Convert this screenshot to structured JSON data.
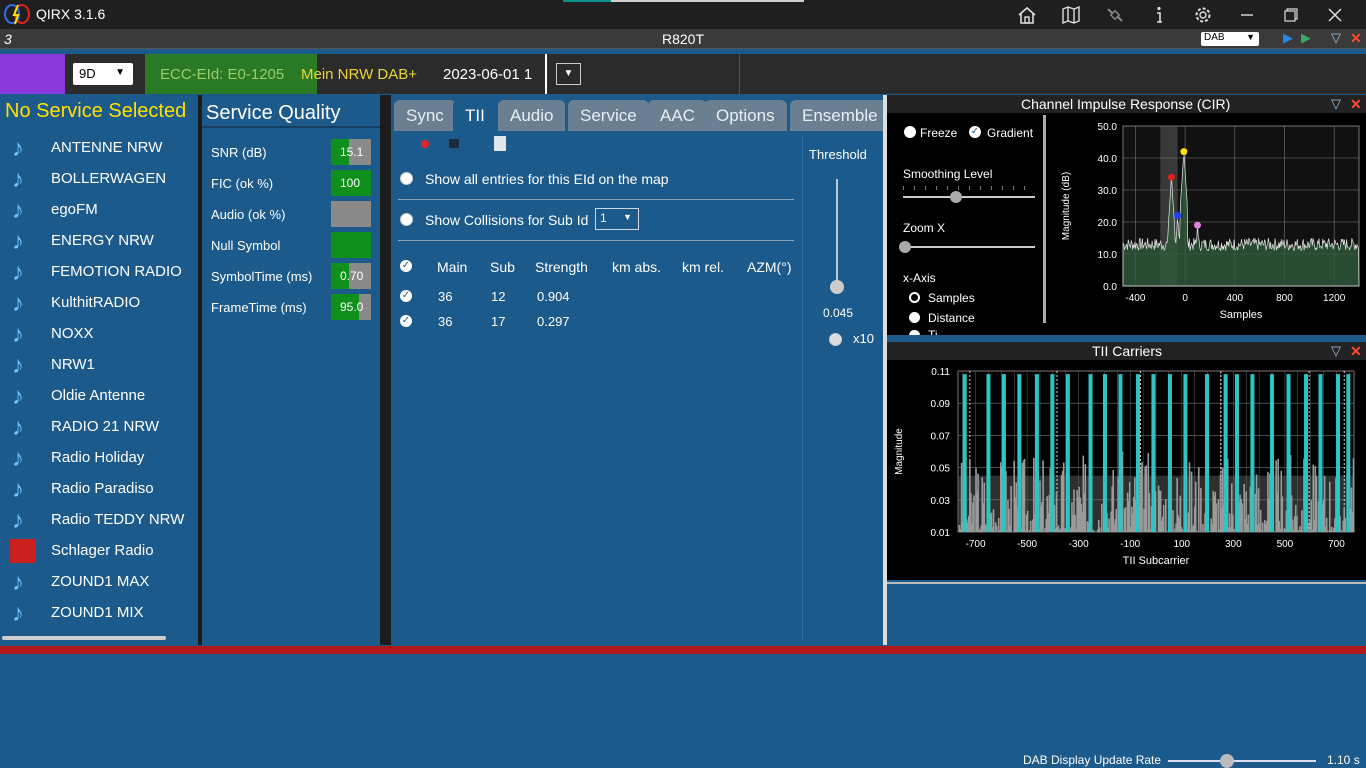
{
  "app": {
    "title": "QIRX 3.1.6"
  },
  "titlebar_icons": [
    "home-icon",
    "map-icon",
    "satellite-icon",
    "info-icon",
    "gear-icon",
    "minimize-icon",
    "restore-icon",
    "close-icon"
  ],
  "device_bar": {
    "number": "3",
    "device": "R820T",
    "mode": "DAB"
  },
  "channel_bar": {
    "channel": "9D",
    "ecc": "ECC-EId: E0-1205",
    "ensemble": "Mein NRW DAB+",
    "date": "2023-06-01  1"
  },
  "service_list": {
    "title": "No Service Selected",
    "items": [
      "ANTENNE NRW",
      "BOLLERWAGEN",
      "egoFM",
      "ENERGY NRW",
      "FEMOTION RADIO",
      "KulthitRADIO",
      "NOXX",
      "NRW1",
      "Oldie Antenne",
      "RADIO 21 NRW",
      "Radio Holiday",
      "Radio Paradiso",
      "Radio TEDDY NRW",
      "Schlager Radio",
      "ZOUND1 MAX",
      "ZOUND1 MIX"
    ]
  },
  "quality": {
    "title": "Service Quality",
    "rows": [
      {
        "label": "SNR (dB)",
        "value": "15.1",
        "fill": 0.45
      },
      {
        "label": "FIC (ok %)",
        "value": "100",
        "fill": 1.0
      },
      {
        "label": "Audio (ok %)",
        "value": "",
        "fill": 0
      },
      {
        "label": "Null Symbol",
        "value": "",
        "fill": 1.0
      },
      {
        "label": "SymbolTime (ms)",
        "value": "0.70",
        "fill": 0.45
      },
      {
        "label": "FrameTime (ms)",
        "value": "95.0",
        "fill": 0.7
      }
    ]
  },
  "tii": {
    "tabs": [
      "Sync",
      "TII",
      "Audio",
      "Service",
      "AAC",
      "Options",
      "Ensemble"
    ],
    "active_tab": "TII",
    "show_all_label": "Show all entries for this EId on the map",
    "show_collisions_label": "Show Collisions for Sub Id",
    "sub_id": "1",
    "threshold_label": "Threshold",
    "threshold_value": "0.045",
    "x10_label": "x10",
    "columns": [
      "Main",
      "Sub",
      "Strength",
      "km abs.",
      "km rel.",
      "AZM(°)"
    ],
    "rows": [
      {
        "main": "36",
        "sub": "12",
        "strength": "0.904"
      },
      {
        "main": "36",
        "sub": "17",
        "strength": "0.297"
      }
    ]
  },
  "cir": {
    "title": "Channel Impulse Response (CIR)",
    "freeze_label": "Freeze",
    "gradient_label": "Gradient",
    "smoothing_label": "Smoothing Level",
    "zoomx_label": "Zoom X",
    "xaxis_label": "x-Axis",
    "xaxis_options": [
      "Samples",
      "Distance",
      "Ti"
    ],
    "selected_xaxis": "Samples",
    "smoothing_level": 0.4,
    "zoom_level": 0.0
  },
  "tii_carriers": {
    "title": "TII Carriers"
  },
  "bottom": {
    "rate_label": "DAB Display Update Rate",
    "rate_value": "1.10 s",
    "rate_level": 0.4
  },
  "chart_data": [
    {
      "type": "area",
      "title": "",
      "xlabel": "Samples",
      "ylabel": "Magnitude (dB)",
      "xlim": [
        -500,
        1400
      ],
      "ylim": [
        0,
        50
      ],
      "xticks": [
        "-400",
        "0",
        "400",
        "800",
        "1200"
      ],
      "yticks": [
        "0.0",
        "10.0",
        "20.0",
        "30.0",
        "40.0",
        "50.0"
      ],
      "peaks": [
        {
          "x": -110,
          "y": 34,
          "color": "#e02020"
        },
        {
          "x": -10,
          "y": 42,
          "color": "#ffe000"
        },
        {
          "x": -60,
          "y": 22,
          "color": "#2040ff"
        },
        {
          "x": 100,
          "y": 19,
          "color": "#e080e0"
        }
      ],
      "baseline": 13
    },
    {
      "type": "bar",
      "title": "",
      "xlabel": "TII Subcarrier",
      "ylabel": "Magnitude",
      "xlim": [
        -768,
        768
      ],
      "ylim": [
        0.01,
        0.11
      ],
      "xticks": [
        "-700",
        "-500",
        "-300",
        "-100",
        "100",
        "300",
        "500",
        "700"
      ],
      "yticks": [
        "0.01",
        "0.03",
        "0.05",
        "0.07",
        "0.09",
        "0.11"
      ],
      "strong_carriers": [
        -744,
        -740,
        -652,
        -648,
        -592,
        -588,
        -532,
        -528,
        -464,
        -460,
        -404,
        -400,
        -344,
        -340,
        -256,
        -252,
        -200,
        -196,
        -140,
        -136,
        -72,
        -68,
        -12,
        -8,
        52,
        56,
        112,
        116,
        196,
        200,
        268,
        272,
        312,
        316,
        372,
        376,
        448,
        452,
        512,
        516,
        580,
        584,
        636,
        640,
        704,
        708,
        744,
        748
      ],
      "threshold": 0.045
    }
  ]
}
